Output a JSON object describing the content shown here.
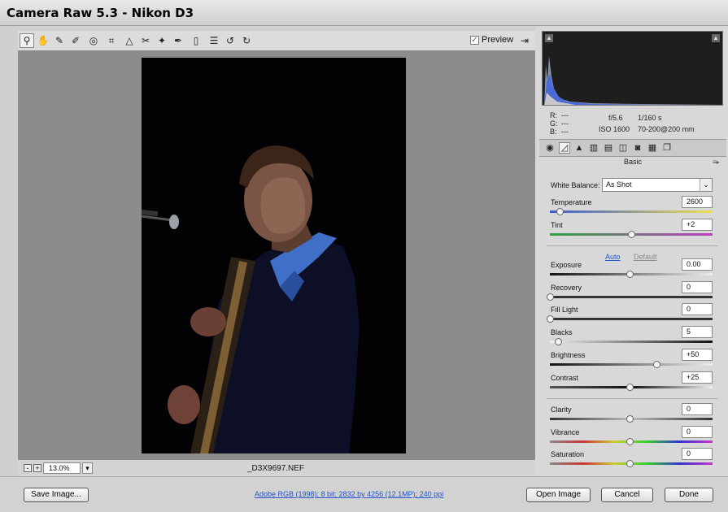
{
  "window": {
    "title": "Camera Raw 5.3  -  Nikon D3"
  },
  "toolbar": {
    "tools": [
      {
        "name": "zoom-tool",
        "icon": "magnifier-icon",
        "glyph": "⚲"
      },
      {
        "name": "hand-tool",
        "icon": "hand-icon",
        "glyph": "✋"
      },
      {
        "name": "white-balance-tool",
        "icon": "eyedropper-icon",
        "glyph": "✎"
      },
      {
        "name": "color-sampler-tool",
        "icon": "sampler-icon",
        "glyph": "✐"
      },
      {
        "name": "targeted-adjustment-tool",
        "icon": "target-icon",
        "glyph": "◎"
      },
      {
        "name": "crop-tool",
        "icon": "crop-icon",
        "glyph": "⌗"
      },
      {
        "name": "straighten-tool",
        "icon": "straighten-icon",
        "glyph": "△"
      },
      {
        "name": "spot-removal-tool",
        "icon": "spot-removal-icon",
        "glyph": "✂"
      },
      {
        "name": "red-eye-tool",
        "icon": "red-eye-icon",
        "glyph": "✦"
      },
      {
        "name": "adjustment-brush-tool",
        "icon": "brush-icon",
        "glyph": "✒"
      },
      {
        "name": "graduated-filter-tool",
        "icon": "gradient-icon",
        "glyph": "▯"
      },
      {
        "name": "preferences-tool",
        "icon": "list-icon",
        "glyph": "☰"
      },
      {
        "name": "rotate-ccw-tool",
        "icon": "rotate-ccw-icon",
        "glyph": "↺"
      },
      {
        "name": "rotate-cw-tool",
        "icon": "rotate-cw-icon",
        "glyph": "↻"
      }
    ],
    "preview_label": "Preview",
    "preview_checked": true
  },
  "statusbar": {
    "zoom_out": "-",
    "zoom_in": "+",
    "zoom": "13.0%",
    "filename": "_D3X9697.NEF"
  },
  "histogram": {
    "r_label": "R:",
    "r_value": "---",
    "g_label": "G:",
    "g_value": "---",
    "b_label": "B:",
    "b_value": "---",
    "aperture": "f/5.6",
    "shutter": "1/160 s",
    "iso": "ISO 1600",
    "lens": "70-200@200 mm"
  },
  "panel_tabs": [
    {
      "name": "tab-basic",
      "icon": "aperture-icon",
      "glyph": "◉",
      "active": false
    },
    {
      "name": "tab-tone-curve",
      "icon": "curve-icon",
      "glyph": "◿",
      "active": true
    },
    {
      "name": "tab-detail",
      "icon": "detail-icon",
      "glyph": "▲",
      "active": false
    },
    {
      "name": "tab-hsl",
      "icon": "hsl-icon",
      "glyph": "▥",
      "active": false
    },
    {
      "name": "tab-split-toning",
      "icon": "split-toning-icon",
      "glyph": "▤",
      "active": false
    },
    {
      "name": "tab-lens-corrections",
      "icon": "lens-icon",
      "glyph": "◫",
      "active": false
    },
    {
      "name": "tab-camera-calibration",
      "icon": "camera-icon",
      "glyph": "◙",
      "active": false
    },
    {
      "name": "tab-presets",
      "icon": "presets-icon",
      "glyph": "▦",
      "active": false
    },
    {
      "name": "tab-snapshots",
      "icon": "snapshots-icon",
      "glyph": "❐",
      "active": false
    }
  ],
  "panel": {
    "title": "Basic",
    "white_balance_label": "White Balance:",
    "white_balance_value": "As Shot",
    "auto_label": "Auto",
    "default_label": "Default",
    "sliders": [
      {
        "key": "temperature",
        "label": "Temperature",
        "value": "2600",
        "position": 0.06
      },
      {
        "key": "tint",
        "label": "Tint",
        "value": "+2",
        "position": 0.51
      },
      {
        "key": "exposure",
        "label": "Exposure",
        "value": "0.00",
        "position": 0.5
      },
      {
        "key": "recovery",
        "label": "Recovery",
        "value": "0",
        "position": 0.0
      },
      {
        "key": "fill-light",
        "label": "Fill Light",
        "value": "0",
        "position": 0.0
      },
      {
        "key": "blacks",
        "label": "Blacks",
        "value": "5",
        "position": 0.05
      },
      {
        "key": "brightness",
        "label": "Brightness",
        "value": "+50",
        "position": 0.67
      },
      {
        "key": "contrast",
        "label": "Contrast",
        "value": "+25",
        "position": 0.5
      },
      {
        "key": "clarity",
        "label": "Clarity",
        "value": "0",
        "position": 0.5
      },
      {
        "key": "vibrance",
        "label": "Vibrance",
        "value": "0",
        "position": 0.5
      },
      {
        "key": "saturation",
        "label": "Saturation",
        "value": "0",
        "position": 0.5
      }
    ]
  },
  "bottom": {
    "save_label": "Save Image...",
    "workflow_link": "Adobe RGB (1998); 8 bit; 2832 by 4256 (12.1MP); 240 ppi",
    "open_label": "Open Image",
    "cancel_label": "Cancel",
    "done_label": "Done"
  },
  "colors": {
    "link": "#2255cc",
    "temperature_track": [
      "#3a5bd0",
      "#f0e050"
    ],
    "tint_track": [
      "#2fa040",
      "#c040c0"
    ]
  }
}
